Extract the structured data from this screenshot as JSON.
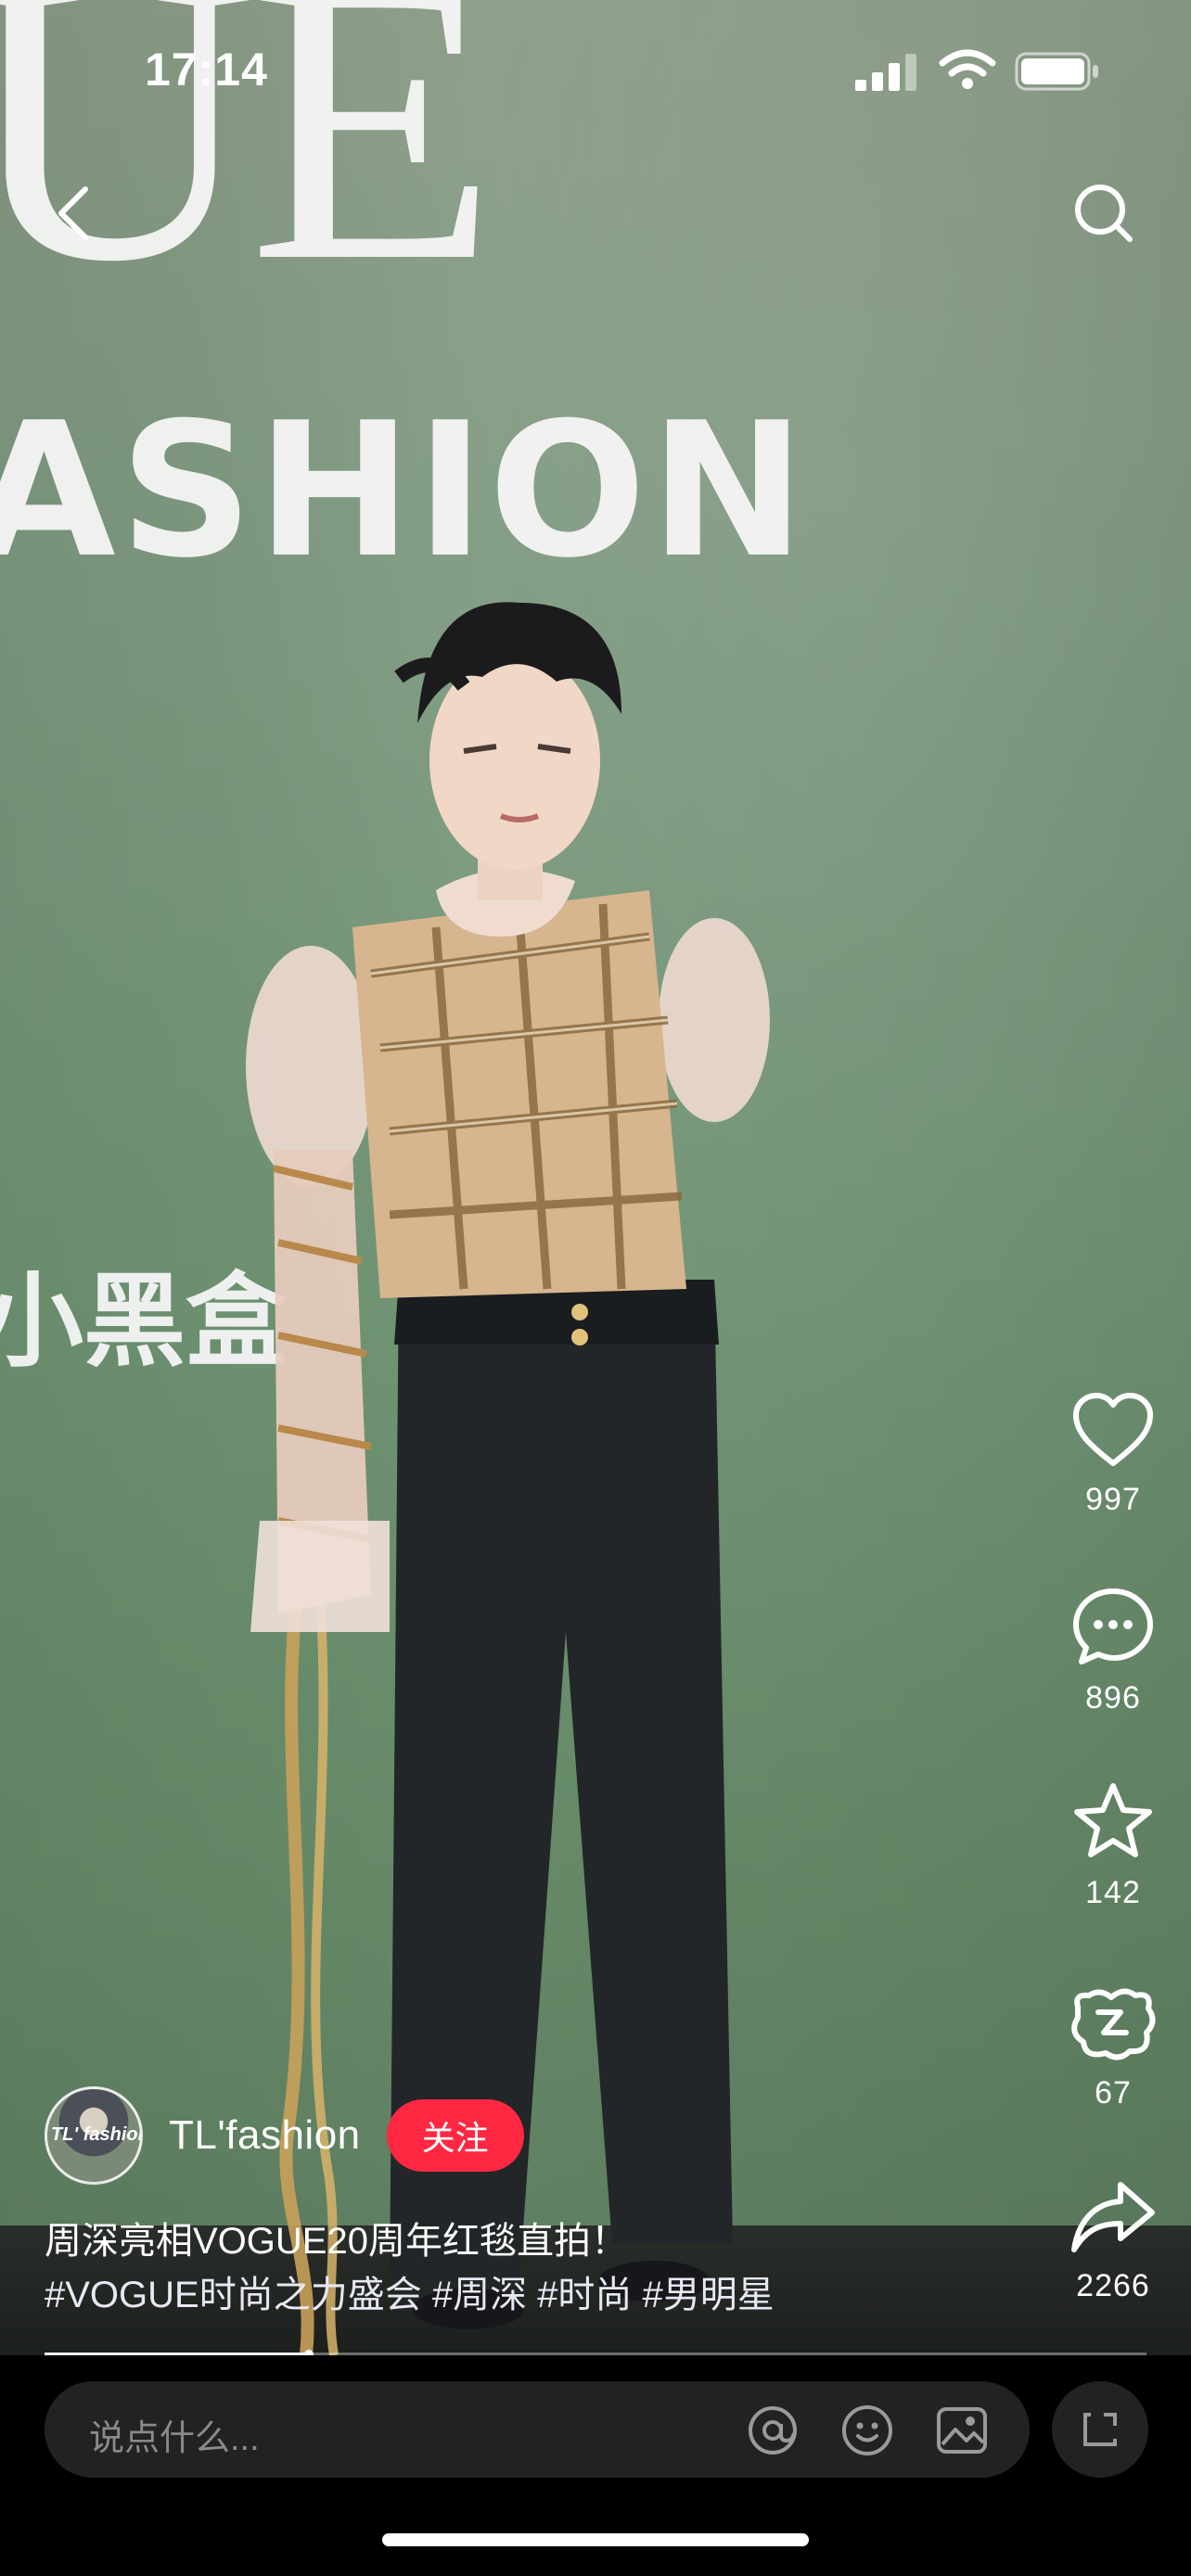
{
  "status_bar": {
    "time": "17:14"
  },
  "backdrop": {
    "brand_top": "UE",
    "brand_fashion": "ASHION",
    "brand_box": "小黑盒"
  },
  "actions": {
    "like_count": "997",
    "comment_count": "896",
    "collect_count": "142",
    "gift_count": "67",
    "share_count": "2266"
  },
  "author": {
    "avatar_text": "TL' fashion",
    "name": "TL'fashion",
    "follow_label": "关注"
  },
  "caption": {
    "title": "周深亮相VOGUE20周年红毯直拍！",
    "tags": "#VOGUE时尚之力盛会 #周深 #时尚 #男明星"
  },
  "playback": {
    "progress": 0.24
  },
  "comment_bar": {
    "placeholder": "说点什么..."
  },
  "icons": {
    "back": "chevron-left-icon",
    "search": "search-icon",
    "like": "heart-icon",
    "comment": "chat-bubble-icon",
    "collect": "star-icon",
    "gift": "gift-icon",
    "share": "share-arrow-icon",
    "mention": "at-sign-icon",
    "emoji": "emoji-icon",
    "image": "image-icon",
    "expand": "expand-icon"
  },
  "colors": {
    "follow": "#ff2741",
    "video_bg": "#6f9473"
  }
}
